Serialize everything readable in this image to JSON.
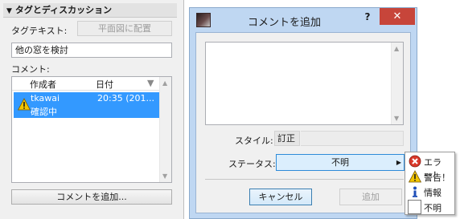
{
  "left_panel": {
    "section_title": "タグとディスカッション",
    "tag_text_label": "タグテキスト:",
    "place_on_plan_button": "平面図に配置",
    "tag_text_value": "他の窓を検討",
    "comment_label": "コメント:",
    "list": {
      "columns": [
        "作成者",
        "日付"
      ],
      "rows": [
        {
          "author": "tkawai",
          "date": "20:35 (201...",
          "status": "確認中",
          "icon": "warning-icon"
        }
      ]
    },
    "add_comment_button": "コメントを追加..."
  },
  "dialog": {
    "title": "コメントを追加",
    "help": "?",
    "close": "✕",
    "comment_text": "",
    "style_label": "スタイル:",
    "style_value": "訂正",
    "status_label": "ステータス:",
    "status_value": "不明",
    "cancel_button": "キャンセル",
    "add_button": "追加"
  },
  "status_menu": {
    "items": [
      {
        "label": "エラー！",
        "icon": "error-icon",
        "color": "#d9392b"
      },
      {
        "label": "警告！",
        "icon": "warning-icon",
        "color": "#f2c500"
      },
      {
        "label": "情報",
        "icon": "info-icon",
        "color": "#1f4fb8"
      },
      {
        "label": "不明",
        "icon": "blank-icon",
        "color": "#ffffff"
      }
    ]
  },
  "colors": {
    "selection": "#3399ff",
    "close_button": "#c7453a",
    "dialog_frame": "#bfd7f2"
  }
}
